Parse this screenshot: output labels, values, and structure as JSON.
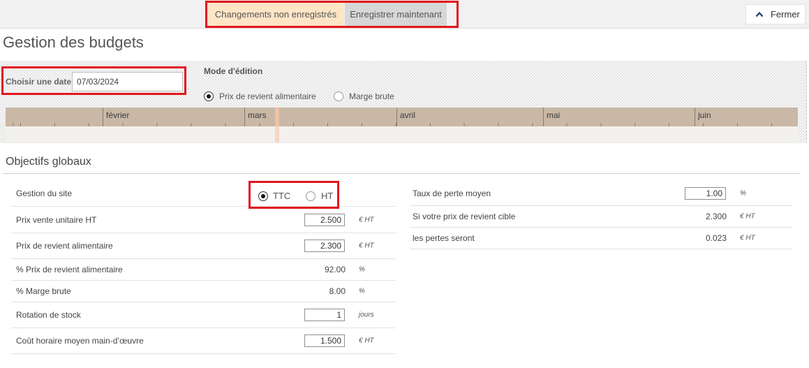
{
  "header": {
    "unsaved_label": "Changements non enregistrés",
    "save_now_label": "Enregistrer maintenant",
    "close_label": "Fermer",
    "close_icon": "chevron-up-icon"
  },
  "page_title": "Gestion des budgets",
  "filters": {
    "date_label": "Choisir une date",
    "date_value": "07/03/2024",
    "edit_mode_label": "Mode d'édition",
    "edit_mode_options": [
      {
        "label": "Prix de revient alimentaire",
        "selected": true
      },
      {
        "label": "Marge brute",
        "selected": false
      }
    ]
  },
  "timeline": {
    "months": [
      "février",
      "mars",
      "avril",
      "mai",
      "juin"
    ]
  },
  "global_objectives": {
    "title": "Objectifs globaux",
    "site_management": {
      "label": "Gestion du site",
      "options": [
        {
          "label": "TTC",
          "selected": true
        },
        {
          "label": "HT",
          "selected": false
        }
      ]
    },
    "left_rows": [
      {
        "label": "Prix vente unitaire HT",
        "value": "2.500",
        "unit": "€ HT"
      },
      {
        "label": "Prix de revient alimentaire",
        "value": "2.300",
        "unit": "€ HT"
      },
      {
        "label": "% Prix de revient alimentaire",
        "value": "92.00",
        "unit": "%"
      },
      {
        "label": "% Marge brute",
        "value": "8.00",
        "unit": "%"
      },
      {
        "label": "Rotation de stock",
        "value": "1",
        "unit": "jours"
      },
      {
        "label": "Coût horaire moyen main-d’œuvre",
        "value": "1.500",
        "unit": "€ HT"
      }
    ],
    "right_rows": [
      {
        "label": "Taux de perte moyen",
        "value": "1.00",
        "unit": "%"
      },
      {
        "label": "Si votre prix de revient cible",
        "value": "2.300",
        "unit": "€ HT"
      },
      {
        "label": "les pertes seront",
        "value": "0.023",
        "unit": "€ HT"
      }
    ]
  },
  "colors": {
    "highlight": "#e2161e",
    "unsaved-bg": "#fde5c6",
    "button-bg": "#d7d7d7",
    "timeline-band": "#c9b8a6",
    "timeline-track": "#f3f1ee",
    "today-marker": "#f0c1a5",
    "close-icon": "#1f3d6b"
  }
}
